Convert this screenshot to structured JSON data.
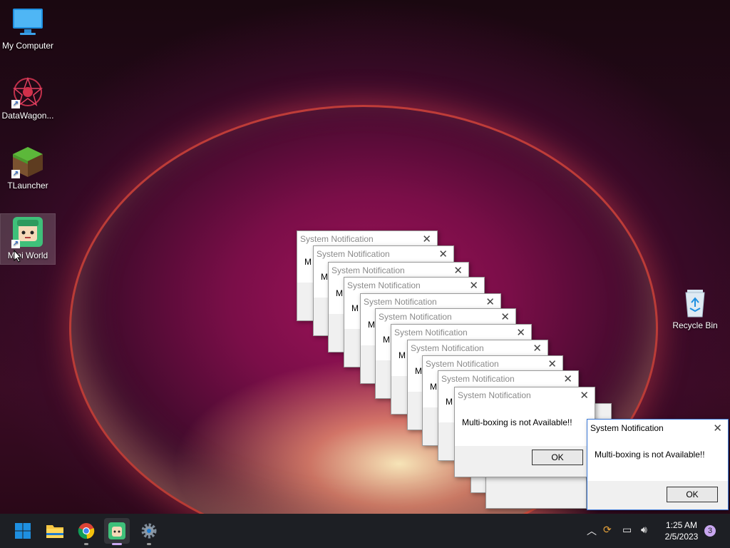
{
  "desktop": {
    "icons": [
      {
        "label": "My Computer"
      },
      {
        "label": "DataWagon..."
      },
      {
        "label": "TLauncher"
      },
      {
        "label": "Mini World"
      },
      {
        "label": "Recycle Bin"
      }
    ]
  },
  "dialogs": {
    "title": "System Notification",
    "stack_message_prefix": "M",
    "message": "Multi-boxing is not Available!!",
    "ok_label": "OK"
  },
  "taskbar": {
    "apps": [
      "Start",
      "File Explorer",
      "Google Chrome",
      "Mini World",
      "Settings"
    ],
    "tray": {
      "time": "1:25 AM",
      "date": "2/5/2023",
      "notification_count": "3"
    }
  },
  "colors": {
    "taskbar": "#1d1f24",
    "windows_blue": "#1e8fe0",
    "notification_badge": "#c9a7f0"
  }
}
